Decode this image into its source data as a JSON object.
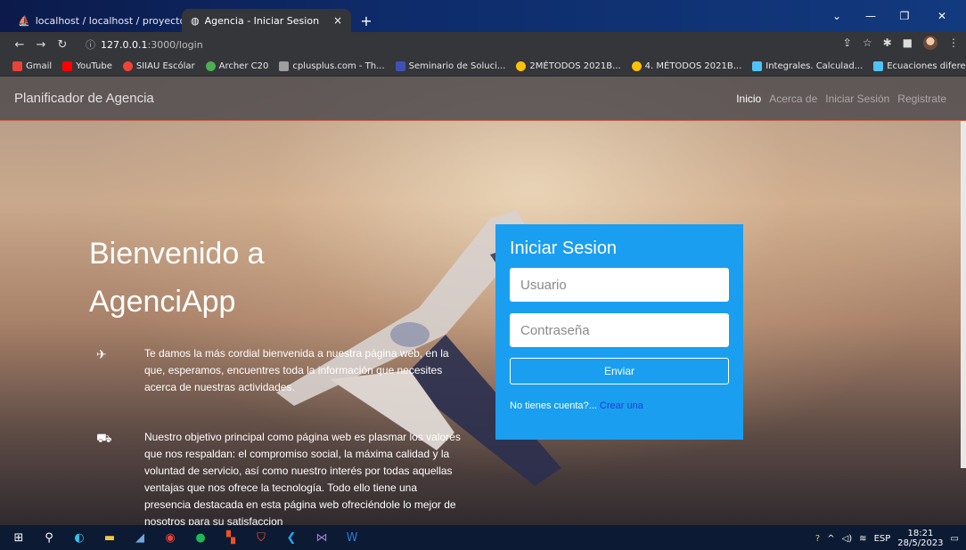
{
  "browser": {
    "tabs": [
      {
        "title": "localhost / localhost / proyecto /",
        "close": "×"
      },
      {
        "title": "Agencia - Iniciar Sesion",
        "close": "×"
      }
    ],
    "new_tab": "+",
    "url": {
      "host": "127.0.0.1",
      "path": ":3000/login"
    },
    "bookmarks": [
      {
        "label": "Gmail",
        "color": "#ea4335"
      },
      {
        "label": "YouTube",
        "color": "#ff0000"
      },
      {
        "label": "SIIAU Escólar",
        "color": "#f44336"
      },
      {
        "label": "Archer C20",
        "color": "#4caf50"
      },
      {
        "label": "cplusplus.com - Th...",
        "color": "#9e9e9e"
      },
      {
        "label": "Seminario de Soluci...",
        "color": "#3f51b5"
      },
      {
        "label": "2MÉTODOS 2021B...",
        "color": "#ffc107"
      },
      {
        "label": "4. MÉTODOS 2021B...",
        "color": "#ffc107"
      },
      {
        "label": "Integrales. Calculad...",
        "color": "#4fc3f7"
      },
      {
        "label": "Ecuaciones diferenc...",
        "color": "#4fc3f7"
      }
    ]
  },
  "navbar": {
    "brand": "Planificador de Agencia",
    "links": [
      "Inicio",
      "Acerca de",
      "Iniciar Sesión",
      "Registrate"
    ]
  },
  "hero": {
    "title": "Bienvenido a AgenciApp",
    "features": [
      {
        "icon": "airplane-icon",
        "glyph": "✈",
        "text": "Te damos la más cordial bienvenida a nuestra página web, en la que, esperamos, encuentres toda la información que necesites acerca de nuestras actividades."
      },
      {
        "icon": "bus-icon",
        "glyph": "⛟",
        "text": "Nuestro objetivo principal como página web es plasmar los valores que nos respaldan: el compromiso social, la máxima calidad y la voluntad de servicio, así como nuestro interés por todas aquellas ventajas que nos ofrece la tecnología. Todo ello tiene una presencia destacada en esta página web ofreciéndole lo mejor de nosotros para su satisfaccion"
      }
    ]
  },
  "login": {
    "title": "Iniciar Sesion",
    "username_placeholder": "Usuario",
    "password_placeholder": "Contraseña",
    "submit": "Enviar",
    "signup_prompt": "No tienes cuenta?...",
    "signup_link": "Crear una"
  },
  "taskbar": {
    "tray_lang": "ESP",
    "time": "18:21",
    "date": "28/5/2023"
  },
  "colors": {
    "card": "#1a9ff0",
    "nav_border": "#c86a4f",
    "link": "#1a3fd6"
  }
}
